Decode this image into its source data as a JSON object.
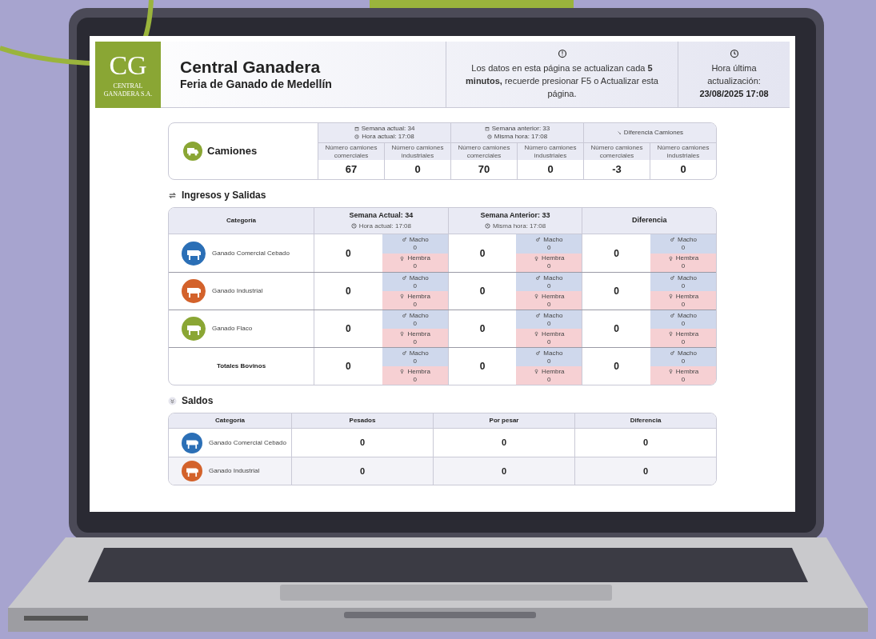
{
  "header": {
    "logo": {
      "initials": "CG",
      "line_1": "CENTRAL",
      "line_2": "GANADERA S.A."
    },
    "title": "Central Ganadera",
    "subtitle": "Feria de Ganado de Medellín",
    "notice": "Los datos en esta página se actualizan cada **5 minutos,** recuerde presionar F5 o Actualizar esta página.",
    "update_label": "Hora última actualización:",
    "update_value": "23/08/2025 17:08"
  },
  "camiones": {
    "title": "Camiones",
    "groups": [
      {
        "kind": "week",
        "line_1": "Semana actual: 34",
        "line_2": "Hora actual: 17:08",
        "columns": [
          {
            "label": "Número camiones comerciales",
            "value": "67"
          },
          {
            "label": "Número camiones industriales",
            "value": "0"
          }
        ]
      },
      {
        "kind": "week",
        "line_1": "Semana anterior: 33",
        "line_2": "Misma hora: 17:08",
        "columns": [
          {
            "label": "Número camiones comerciales",
            "value": "70"
          },
          {
            "label": "Número camiones industriales",
            "value": "0"
          }
        ]
      },
      {
        "kind": "difference",
        "line_1": "Diferencia Camiones",
        "columns": [
          {
            "label": "Número camiones comerciales",
            "value": "-3"
          },
          {
            "label": "Número camiones industriales",
            "value": "0"
          }
        ]
      }
    ]
  },
  "ingresos": {
    "title": "Ingresos y Salidas",
    "category_header": "Categoría",
    "columns": [
      {
        "title": "Semana Actual: 34",
        "note": "Hora actual: 17:08"
      },
      {
        "title": "Semana Anterior: 33",
        "note": "Misma hora: 17:08"
      },
      {
        "title": "Diferencia"
      }
    ],
    "rows": [
      {
        "category": "Ganado Comercial Cebado",
        "color": "#2b6fb6",
        "cells": [
          {
            "total": "0",
            "macho": "Macho",
            "macho_value": "0",
            "hembra": "Hembra",
            "hembra_value": "0"
          },
          {
            "total": "0",
            "macho": "Macho",
            "macho_value": "0",
            "hembra": "Hembra",
            "hembra_value": "0"
          },
          {
            "total": "0",
            "macho": "Macho",
            "macho_value": "0",
            "hembra": "Hembra",
            "hembra_value": "0"
          }
        ]
      },
      {
        "category": "Ganado Industrial",
        "color": "#d3622b",
        "cells": [
          {
            "total": "0",
            "macho": "Macho",
            "macho_value": "0",
            "hembra": "Hembra",
            "hembra_value": "0"
          },
          {
            "total": "0",
            "macho": "Macho",
            "macho_value": "0",
            "hembra": "Hembra",
            "hembra_value": "0"
          },
          {
            "total": "0",
            "macho": "Macho",
            "macho_value": "0",
            "hembra": "Hembra",
            "hembra_value": "0"
          }
        ]
      },
      {
        "category": "Ganado Flaco",
        "color": "#8aa634",
        "cells": [
          {
            "total": "0",
            "macho": "Macho",
            "macho_value": "0",
            "hembra": "Hembra",
            "hembra_value": "0"
          },
          {
            "total": "0",
            "macho": "Macho",
            "macho_value": "0",
            "hembra": "Hembra",
            "hembra_value": "0"
          },
          {
            "total": "0",
            "macho": "Macho",
            "macho_value": "0",
            "hembra": "Hembra",
            "hembra_value": "0"
          }
        ]
      },
      {
        "category": "Totales Bovinos",
        "kind": "total",
        "cells": [
          {
            "total": "0",
            "macho": "Macho",
            "macho_value": "0",
            "hembra": "Hembra",
            "hembra_value": "0"
          },
          {
            "total": "0",
            "macho": "Macho",
            "macho_value": "0",
            "hembra": "Hembra",
            "hembra_value": "0"
          },
          {
            "total": "0",
            "macho": "Macho",
            "macho_value": "0",
            "hembra": "Hembra",
            "hembra_value": "0"
          }
        ]
      }
    ]
  },
  "saldos": {
    "title": "Saldos",
    "columns": [
      "Categoría",
      "Pesados",
      "Por pesar",
      "Diferencia"
    ],
    "rows": [
      {
        "category": "Ganado Comercial Cebado",
        "color": "#2b6fb6",
        "values": [
          "0",
          "0",
          "0"
        ]
      },
      {
        "category": "Ganado Industrial",
        "color": "#d3622b",
        "values": [
          "0",
          "0",
          "0"
        ]
      }
    ]
  }
}
